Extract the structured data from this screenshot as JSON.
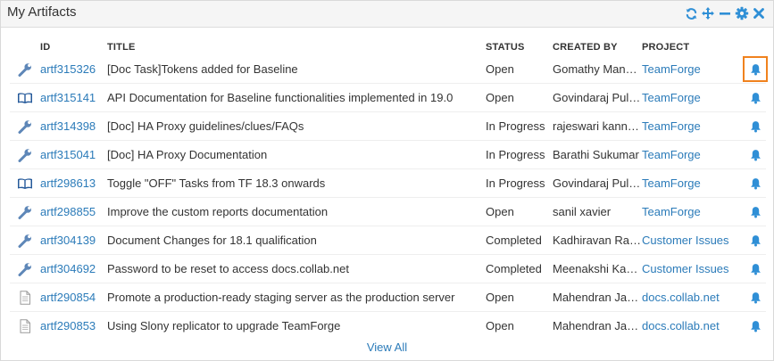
{
  "widget": {
    "title": "My Artifacts",
    "tools": [
      "refresh-icon",
      "move-icon",
      "minimize-icon",
      "settings-icon",
      "close-icon"
    ]
  },
  "columns": {
    "id": "ID",
    "title": "TITLE",
    "status": "STATUS",
    "created_by": "CREATED BY",
    "project": "PROJECT"
  },
  "rows": [
    {
      "type": "task",
      "id": "artf315326",
      "title": "[Doc Task]Tokens added for Baseline",
      "status": "Open",
      "created_by": "Gomathy Man…",
      "project": "TeamForge"
    },
    {
      "type": "doc",
      "id": "artf315141",
      "title": "API Documentation for Baseline functionalities implemented in 19.0",
      "status": "Open",
      "created_by": "Govindaraj Pul…",
      "project": "TeamForge"
    },
    {
      "type": "task",
      "id": "artf314398",
      "title": "[Doc] HA Proxy guidelines/clues/FAQs",
      "status": "In Progress",
      "created_by": "rajeswari kann…",
      "project": "TeamForge"
    },
    {
      "type": "task",
      "id": "artf315041",
      "title": "[Doc] HA Proxy Documentation",
      "status": "In Progress",
      "created_by": "Barathi Sukumar",
      "project": "TeamForge"
    },
    {
      "type": "doc",
      "id": "artf298613",
      "title": "Toggle \"OFF\" Tasks from TF 18.3 onwards",
      "status": "In Progress",
      "created_by": "Govindaraj Pul…",
      "project": "TeamForge"
    },
    {
      "type": "task",
      "id": "artf298855",
      "title": "Improve the custom reports documentation",
      "status": "Open",
      "created_by": "sanil xavier",
      "project": "TeamForge"
    },
    {
      "type": "task",
      "id": "artf304139",
      "title": "Document Changes for 18.1 qualification",
      "status": "Completed",
      "created_by": "Kadhiravan Ra…",
      "project": "Customer Issues"
    },
    {
      "type": "task",
      "id": "artf304692",
      "title": "Password to be reset to access docs.collab.net",
      "status": "Completed",
      "created_by": "Meenakshi Ka…",
      "project": "Customer Issues"
    },
    {
      "type": "page",
      "id": "artf290854",
      "title": "Promote a production-ready staging server as the production server",
      "status": "Open",
      "created_by": "Mahendran Ja…",
      "project": "docs.collab.net"
    },
    {
      "type": "page",
      "id": "artf290853",
      "title": "Using Slony replicator to upgrade TeamForge",
      "status": "Open",
      "created_by": "Mahendran Ja…",
      "project": "docs.collab.net"
    }
  ],
  "row_action_icon": "bell-icon",
  "focused_row": 0,
  "view_all": "View All",
  "colors": {
    "link": "#2b7bb9",
    "bell": "#2f8fd6",
    "focus": "#f0821e",
    "header_bg": "#f5f5f5"
  }
}
